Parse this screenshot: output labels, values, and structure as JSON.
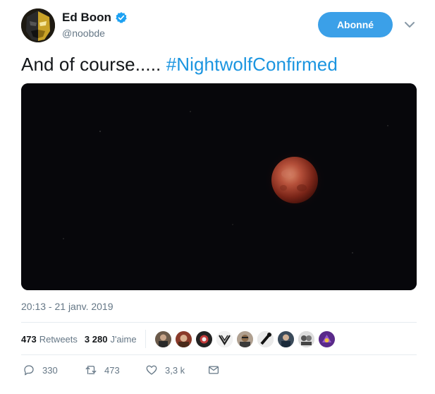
{
  "user": {
    "display_name": "Ed Boon",
    "handle": "@noobde",
    "verified": true,
    "avatar_icon": "scorpion-mask-avatar"
  },
  "follow_button": {
    "label": "Abonné"
  },
  "tweet": {
    "text": "And of course..... ",
    "hashtag": "#NightwolfConfirmed",
    "media_description": "blood-moon-photo",
    "timestamp": "20:13 - 21 janv. 2019"
  },
  "stats": {
    "retweets_count": "473",
    "retweets_label": "Retweets",
    "likes_count": "3 280",
    "likes_label": "J'aime"
  },
  "actions": {
    "replies": "330",
    "retweets": "473",
    "likes": "3,3 k"
  },
  "colors": {
    "accent": "#1b95e0",
    "follow_button": "#3ba0e8",
    "muted_text": "#657786"
  }
}
